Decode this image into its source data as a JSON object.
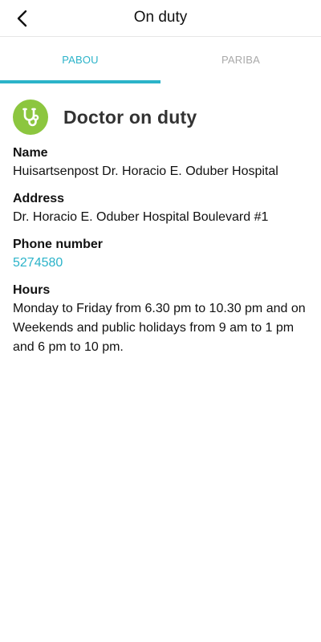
{
  "header": {
    "title": "On duty"
  },
  "tabs": [
    {
      "label": "PABOU",
      "active": true
    },
    {
      "label": "PARIBA",
      "active": false
    }
  ],
  "section": {
    "title": "Doctor on duty",
    "icon": "stethoscope-icon",
    "icon_bg": "#8cc63f"
  },
  "fields": {
    "name": {
      "label": "Name",
      "value": "Huisartsenpost Dr. Horacio E. Oduber Hospital"
    },
    "address": {
      "label": "Address",
      "value": "Dr. Horacio E. Oduber Hospital Boulevard #1"
    },
    "phone": {
      "label": "Phone number",
      "value": "5274580"
    },
    "hours": {
      "label": "Hours",
      "value": "Monday to Friday from 6.30 pm to 10.30 pm and on Weekends and public holidays from 9 am to 1 pm and 6 pm to 10 pm."
    }
  },
  "colors": {
    "accent": "#2bb3c9",
    "badge": "#8cc63f"
  }
}
